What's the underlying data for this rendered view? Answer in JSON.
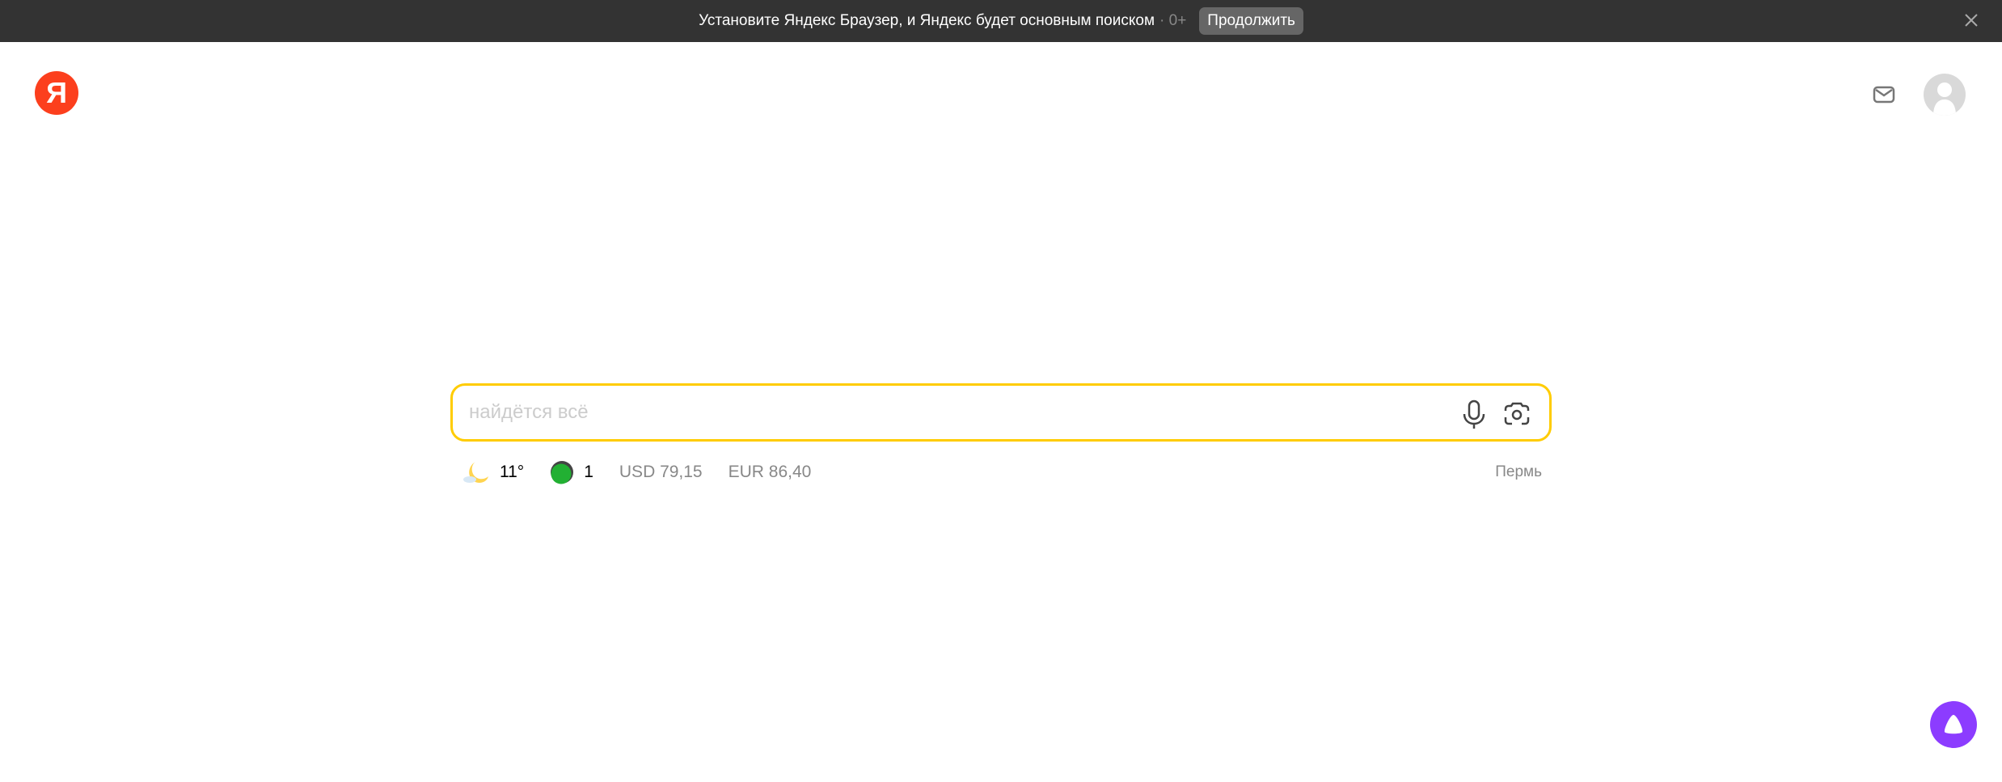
{
  "banner": {
    "text": "Установите Яндекс Браузер, и Яндекс будет основным поиском",
    "age": "· 0+",
    "continue_label": "Продолжить"
  },
  "logo": {
    "letter": "Я"
  },
  "search": {
    "placeholder": "найдётся всё",
    "value": ""
  },
  "informers": {
    "temperature": "11°",
    "traffic": "1",
    "usd": "USD 79,15",
    "eur": "EUR 86,40",
    "city": "Пермь"
  },
  "colors": {
    "accent": "#ffcc00",
    "brand": "#fc3f1d",
    "alice": "#8c3cff",
    "banner": "#333333"
  }
}
